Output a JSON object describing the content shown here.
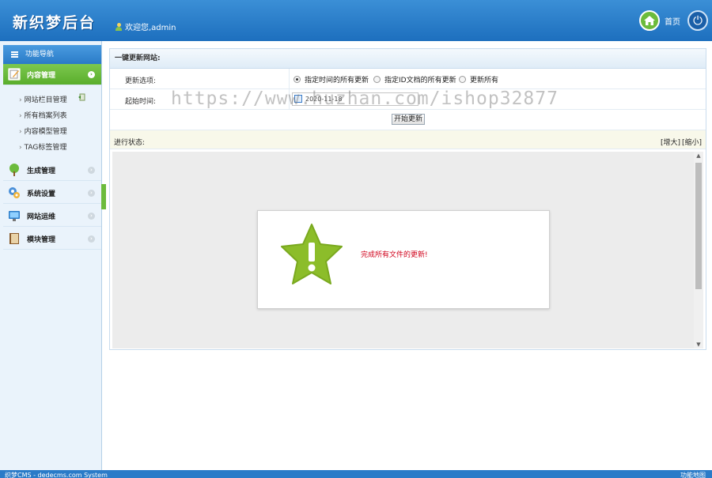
{
  "header": {
    "logo": "新织梦后台",
    "welcome": "欢迎您,admin",
    "home_label": "首页",
    "power_glyph": "⏻"
  },
  "sidebar": {
    "nav_title": "功能导航",
    "sections": [
      {
        "label": "内容管理",
        "active": true,
        "icon": "edit-icon"
      },
      {
        "label": "生成管理",
        "active": false,
        "icon": "tree-icon"
      },
      {
        "label": "系统设置",
        "active": false,
        "icon": "gear-icon"
      },
      {
        "label": "网站运维",
        "active": false,
        "icon": "monitor-icon"
      },
      {
        "label": "模块管理",
        "active": false,
        "icon": "book-icon"
      }
    ],
    "content_items": [
      "网站栏目管理",
      "所有档案列表",
      "内容模型管理",
      "TAG标签管理"
    ]
  },
  "main": {
    "panel_title": "一键更新网站:",
    "update_label": "更新选项:",
    "options": [
      {
        "label": "指定时间的所有更新",
        "checked": true
      },
      {
        "label": "指定ID文档的所有更新",
        "checked": false
      },
      {
        "label": "更新所有",
        "checked": false
      }
    ],
    "start_time_label": "起始时间:",
    "start_time_value": "2020-11-18",
    "start_button": "开始更新",
    "status_label": "进行状态:",
    "enlarge": "[增大]",
    "shrink": "[缩小]",
    "message": "完成所有文件的更新!"
  },
  "watermark": "https://www.huzhan.com/ishop32877",
  "footer": {
    "left": "织梦CMS - dedecms.com System",
    "right": "功能地图"
  },
  "colors": {
    "brand_blue": "#1d6fbe",
    "active_green": "#5aae2c",
    "star_green": "#8cbd2a",
    "message_red": "#d0021b"
  }
}
